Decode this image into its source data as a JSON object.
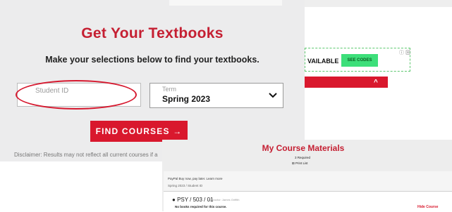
{
  "textbooks": {
    "title": "Get Your Textbooks",
    "subtitle": "Make your selections below to find your textbooks.",
    "student_id_placeholder": "Student ID",
    "term_label": "Term",
    "term_value": "Spring 2023",
    "find_courses_label": "FIND COURSES  →",
    "disclaimer": "Disclaimer: Results may not reflect all current courses if a"
  },
  "ad": {
    "text": "VAILABLE",
    "button_label": "SEE CODES",
    "close_label": "ⓘ ⊠"
  },
  "collapse": {
    "icon": "^"
  },
  "materials": {
    "title": "My Course Materials",
    "required": "3 Required",
    "print_list": "⊞ Print List",
    "paypal": "PayPal Buy now, pay later. Learn more",
    "term_student": "Spring 2023 / Student ID",
    "course": "PSY / 503 / 01",
    "instructor": "Instructor: James Griffith",
    "no_books": "No books required for this course.",
    "hide_course": "Hide Course"
  },
  "colors": {
    "brand_red": "#d9182d",
    "title_red": "#c51f32",
    "ad_green": "#3ddf7a"
  }
}
